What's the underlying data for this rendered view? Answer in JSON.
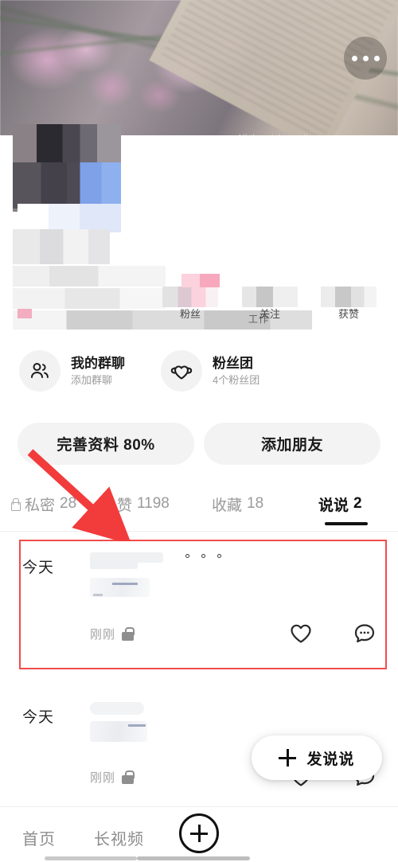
{
  "cover": {
    "caption": "All the wishes will come true",
    "more_icon": "more-horizontal-icon"
  },
  "profile": {
    "stats": [
      {
        "label": "粉丝",
        "value_hidden": true
      },
      {
        "label": "关注",
        "value_hidden": true
      },
      {
        "label": "获赞",
        "value_hidden": true
      }
    ],
    "bio_tail": "工作"
  },
  "entries": [
    {
      "icon": "group-chat-icon",
      "title": "我的群聊",
      "subtitle": "添加群聊"
    },
    {
      "icon": "fan-club-heart-icon",
      "title": "粉丝团",
      "subtitle": "4个粉丝团"
    }
  ],
  "actions": {
    "complete_profile": "完善资料 80%",
    "add_friend": "添加朋友"
  },
  "tabs": [
    {
      "label": "私密",
      "count": "28",
      "locked": true,
      "active": false
    },
    {
      "label": "赞",
      "count": "1198",
      "locked": true,
      "active": false
    },
    {
      "label": "收藏",
      "count": "18",
      "locked": false,
      "active": false
    },
    {
      "label": "说说",
      "count": "2",
      "locked": false,
      "active": true
    }
  ],
  "feed": [
    {
      "day": "今天",
      "time": "刚刚",
      "private_icon": "lock-icon",
      "like_icon": "heart-icon",
      "comment_icon": "comment-bubble-icon",
      "menu_icon": "more-dots-icon",
      "highlighted": true
    },
    {
      "day": "今天",
      "time": "刚刚",
      "private_icon": "lock-icon",
      "like_icon": "heart-icon",
      "comment_icon": "comment-bubble-icon",
      "menu_icon": "more-dots-icon",
      "highlighted": false
    }
  ],
  "fab": {
    "icon": "plus-icon",
    "label": "发说说"
  },
  "bottom_nav": {
    "items": [
      {
        "label": "首页"
      },
      {
        "label": "长视频"
      }
    ],
    "center_icon": "plus-circle-icon"
  },
  "annotation": {
    "arrow_color": "#f23b3b",
    "box_color": "#f24b4b"
  }
}
